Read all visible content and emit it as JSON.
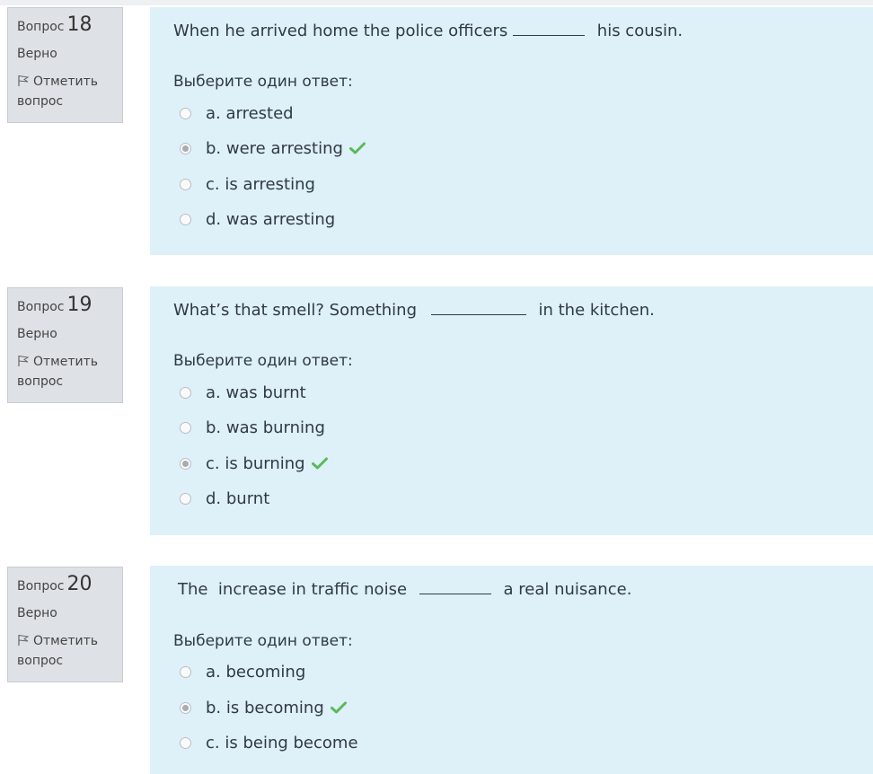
{
  "common": {
    "question_word": "Вопрос",
    "state_correct": "Верно",
    "flag_label_line1": "Отметить",
    "flag_label_line2": "вопрос",
    "prompt": "Выберите один ответ:"
  },
  "questions": [
    {
      "number": "18",
      "text_before": "When he arrived home the police officers",
      "text_after": "his cousin.",
      "options": [
        {
          "label": "a. arrested",
          "selected": false,
          "correct": false
        },
        {
          "label": "b. were arresting",
          "selected": true,
          "correct": true
        },
        {
          "label": "c. is arresting",
          "selected": false,
          "correct": false
        },
        {
          "label": "d. was arresting",
          "selected": false,
          "correct": false
        }
      ]
    },
    {
      "number": "19",
      "text_before": "What’s that smell? Something",
      "text_after": "in the kitchen.",
      "options": [
        {
          "label": "a. was burnt",
          "selected": false,
          "correct": false
        },
        {
          "label": "b. was burning",
          "selected": false,
          "correct": false
        },
        {
          "label": "c. is burning",
          "selected": true,
          "correct": true
        },
        {
          "label": "d. burnt",
          "selected": false,
          "correct": false
        }
      ]
    },
    {
      "number": "20",
      "text_before": "The  increase in traffic noise",
      "text_after": "a real nuisance.",
      "options": [
        {
          "label": "a. becoming",
          "selected": false,
          "correct": false
        },
        {
          "label": "b. is becoming",
          "selected": true,
          "correct": true
        },
        {
          "label": "c. is being become",
          "selected": false,
          "correct": false
        }
      ]
    }
  ],
  "colors": {
    "info_bg": "#dee2e6",
    "content_bg": "#def0f8",
    "correct_check": "#5cb85c"
  }
}
